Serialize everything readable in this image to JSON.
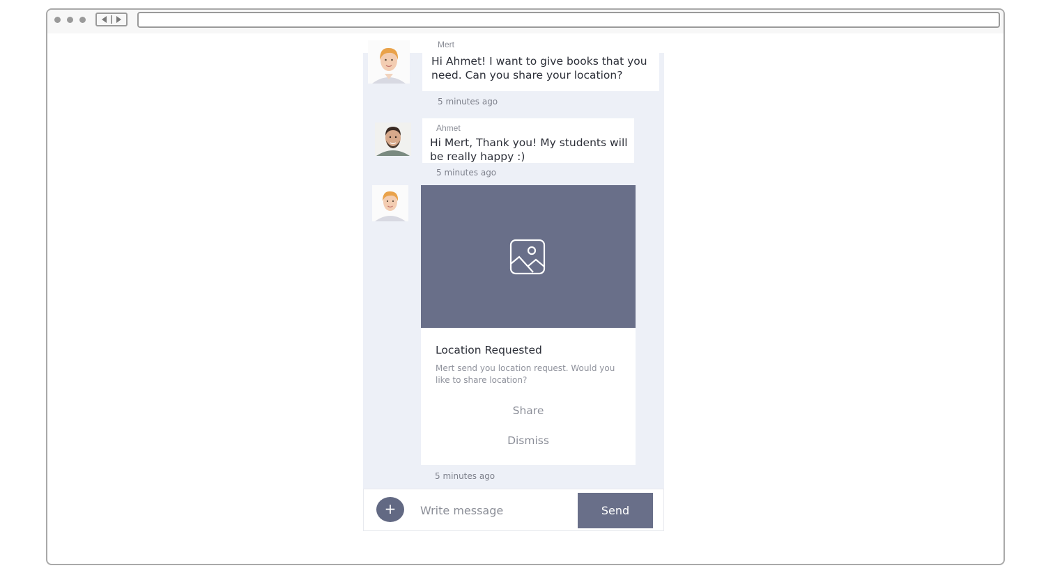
{
  "messages": [
    {
      "sender": "Mert",
      "text": "Hi Ahmet! I want to give books that you need. Can you share your location?",
      "time": "5 minutes ago"
    },
    {
      "sender": "Ahmet",
      "text": "Hi Mert, Thank you! My students will be really happy :)",
      "time": "5 minutes ago"
    }
  ],
  "location_card": {
    "title": "Location Requested",
    "description": "Mert send you location request. Would you like to share location?",
    "share_label": "Share",
    "dismiss_label": "Dismiss",
    "time": "5 minutes ago",
    "image_icon": "image-placeholder-icon"
  },
  "composer": {
    "placeholder": "Write message",
    "send_label": "Send",
    "add_label": "+"
  },
  "colors": {
    "accent": "#696f89",
    "chat_background": "#edf0f7"
  }
}
